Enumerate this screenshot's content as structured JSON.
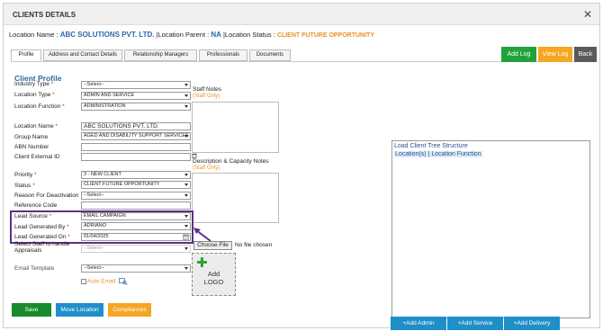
{
  "dialog": {
    "title": "CLIENTS DETAILS",
    "close_glyph": "✕"
  },
  "location_line": {
    "name_label": "Location Name :",
    "name_value": "ABC SOLUTIONS PVT. LTD.",
    "parent_label": "|Location Parent :",
    "parent_value": "NA",
    "status_label": "|Location Status :",
    "status_value": "CLIENT FUTURE OPPORTUNITY"
  },
  "tabs": [
    {
      "label": "Profile",
      "active": true
    },
    {
      "label": "Address and Contact Details",
      "active": false
    },
    {
      "label": "Relationship Managers",
      "active": false
    },
    {
      "label": "Professionals",
      "active": false
    },
    {
      "label": "Documents",
      "active": false
    }
  ],
  "header_buttons": {
    "add_log": "Add Log",
    "view_log": "View Log",
    "back": "Back"
  },
  "form": {
    "section_title": "Client Profile",
    "required_mark": "*",
    "industry_type": {
      "label": "Industry Type",
      "value": "--Select--"
    },
    "location_type": {
      "label": "Location Type",
      "value": "ADMIN AND SERVICE"
    },
    "location_function": {
      "label": "Location Function",
      "value": "ADMINISTRATION"
    },
    "location_name": {
      "label": "Location Name",
      "value": "ABC SOLUTIONS PVT. LTD."
    },
    "group_name": {
      "label": "Group Name",
      "value": "AGED AND DISABILITY SUPPORT SERVICES"
    },
    "abn_number": {
      "label": "ABN Number",
      "value": ""
    },
    "client_external_id": {
      "label": "Client External ID",
      "value": ""
    },
    "priority": {
      "label": "Priority",
      "value": "3 - NEW CLIENT"
    },
    "status": {
      "label": "Status",
      "value": "CLIENT FUTURE OPPORTUNITY"
    },
    "reason_for_deactivation": {
      "label": "Reason For Deactivation",
      "value": "--Select--"
    },
    "reference_code": {
      "label": "Reference Code",
      "value": ""
    },
    "lead_source": {
      "label": "Lead Source",
      "value": "EMAIL CAMPAIGN"
    },
    "lead_generated_by": {
      "label": "Lead Generated By",
      "value": "ADRIANO"
    },
    "lead_generated_on": {
      "label": "Lead Generated On",
      "value": "01/04/2025"
    },
    "select_staff": {
      "label_line1": "Select Staff to handle",
      "label_line2": "Appraisals",
      "value": "--Select--"
    },
    "email_template": {
      "label": "Email Template",
      "value": "--Select--"
    },
    "auto_email": "Auto Email",
    "staff_notes": {
      "label": "Staff Notes",
      "tag": "(Staff Only)"
    },
    "desc_capacity": {
      "label": "Description & Capacity Notes",
      "tag": "(Staff Only)"
    },
    "choose_file": "Choose File",
    "no_file": "No file chosen",
    "add_logo_line1": "Add",
    "add_logo_line2": "LOGO"
  },
  "bottom_buttons": {
    "save": "Save",
    "move_location": "Move Location",
    "compliances": "Compliances"
  },
  "right_panel": {
    "tree_link": "Load Client Tree Structure",
    "locations_link": "Location(s) | Location Function",
    "add_admin": "+Add Admin",
    "add_service": "+Add Service",
    "add_delivery": "+Add Delivery"
  },
  "colors": {
    "blue_text": "#2a69a8",
    "orange": "#f5a623",
    "green": "#22a23a",
    "dark_green": "#1a8a2e",
    "button_blue": "#1e8fc9",
    "back_gray": "#5a5a5a",
    "highlight_border": "#5c2f8a"
  }
}
